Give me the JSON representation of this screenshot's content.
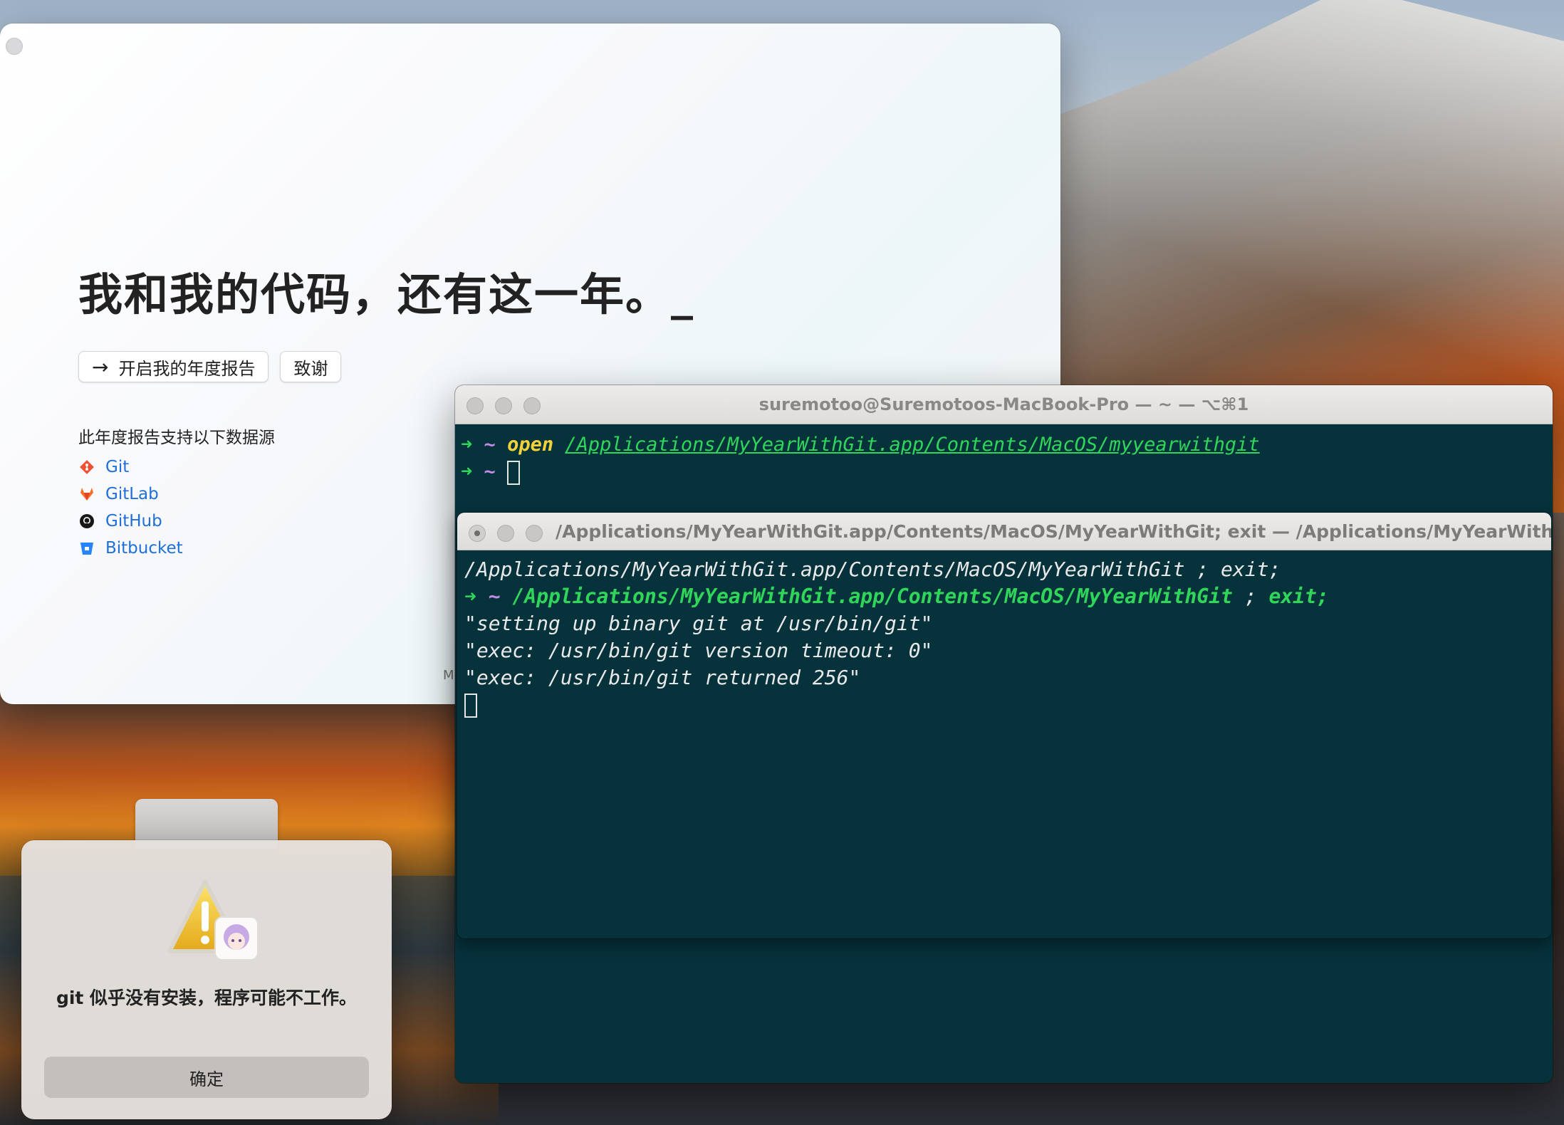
{
  "app": {
    "hero_title": "我和我的代码，还有这一年。_",
    "start_report_label": "开启我的年度报告",
    "thanks_label": "致谢",
    "sources_title": "此年度报告支持以下数据源",
    "sources": [
      {
        "label": "Git",
        "icon": "git-icon",
        "color": "#f05033"
      },
      {
        "label": "GitLab",
        "icon": "gitlab-icon",
        "color": "#fc6d26"
      },
      {
        "label": "GitHub",
        "icon": "github-icon",
        "color": "#181717"
      },
      {
        "label": "Bitbucket",
        "icon": "bitbucket-icon",
        "color": "#2684ff"
      }
    ],
    "clipped_text": "M"
  },
  "terminal1": {
    "title": "suremotoo@Suremotoos-MacBook-Pro — ~ — ⌥⌘1",
    "prompt_arrow": "➜",
    "prompt_dir": "~",
    "command": "open",
    "command_arg": "/Applications/MyYearWithGit.app/Contents/MacOS/myyearwithgit"
  },
  "terminal2": {
    "title": "/Applications/MyYearWithGit.app/Contents/MacOS/MyYearWithGit; exit — /Applications/MyYearWithGit.app/...",
    "line1": "/Applications/MyYearWithGit.app/Contents/MacOS/MyYearWithGit ; exit;",
    "prompt_arrow": "➜",
    "prompt_dir": "~",
    "cmd_path": "/Applications/MyYearWithGit.app/Contents/MacOS/MyYearWithGit",
    "cmd_sep": ";",
    "cmd_exit": "exit;",
    "output": [
      "\"setting up binary git at /usr/bin/git\"",
      "\"exec: /usr/bin/git version timeout: 0\"",
      "\"exec: /usr/bin/git returned 256\""
    ]
  },
  "alert": {
    "message": "git 似乎没有安装，程序可能不工作。",
    "ok_label": "确定"
  }
}
